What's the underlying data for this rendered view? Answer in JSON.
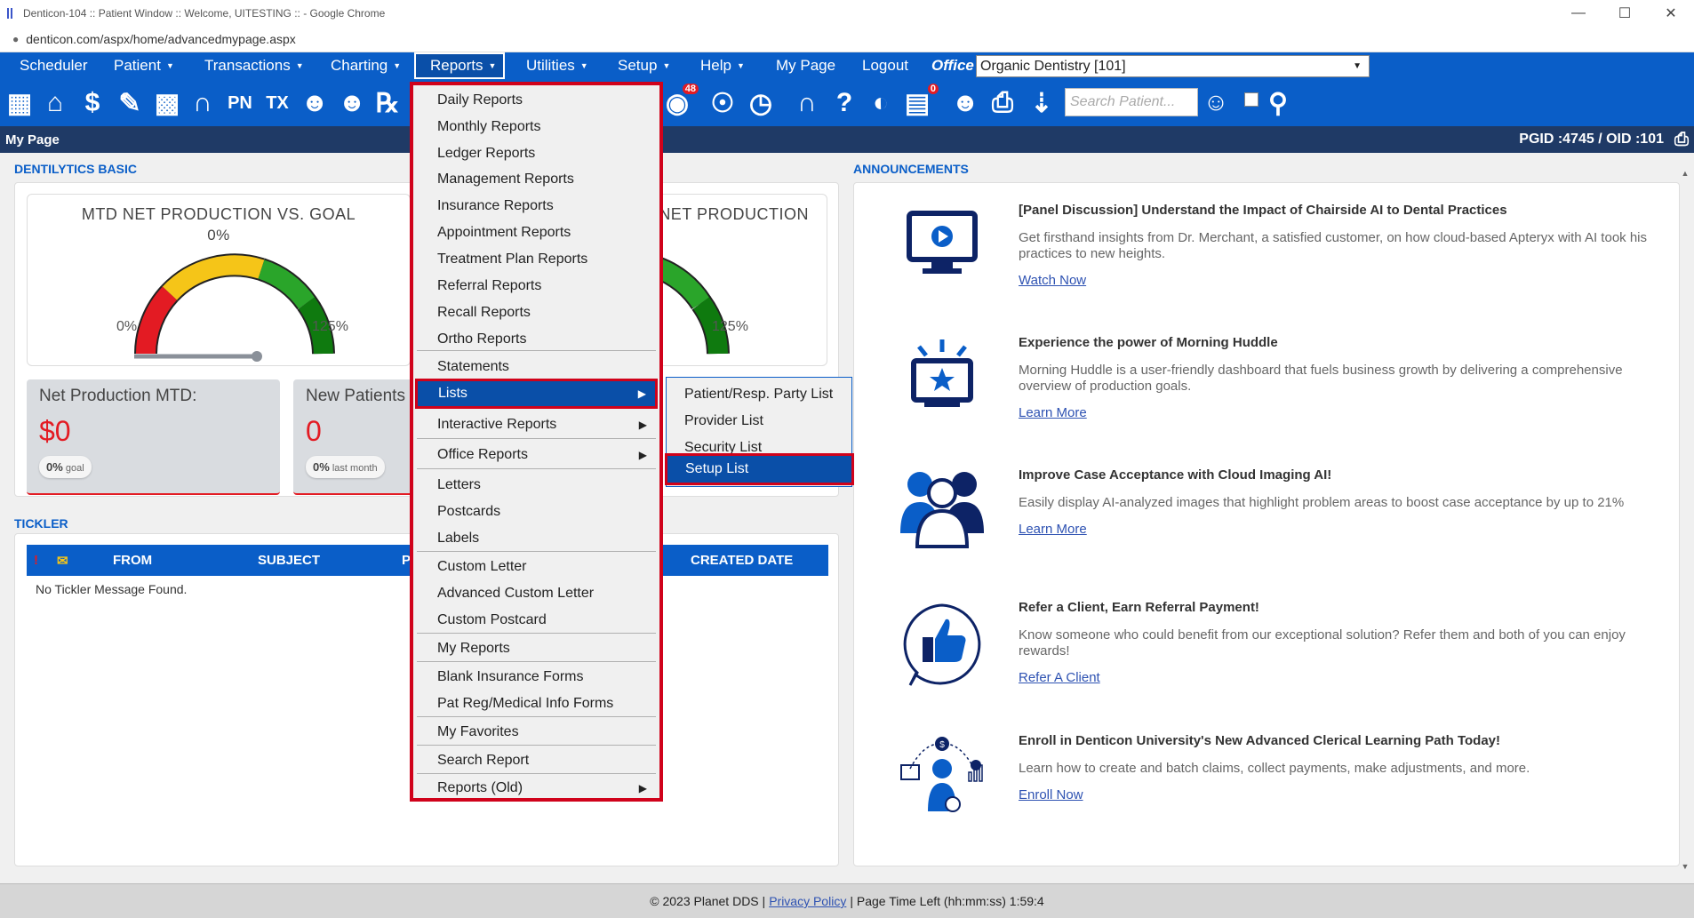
{
  "browser": {
    "title": "Denticon-104 :: Patient Window :: Welcome, UITESTING :: - Google Chrome",
    "url": "denticon.com/aspx/home/advancedmypage.aspx"
  },
  "menu": {
    "items": [
      {
        "label": "Scheduler",
        "caret": false
      },
      {
        "label": "Patient",
        "caret": true
      },
      {
        "label": "Transactions",
        "caret": true
      },
      {
        "label": "Charting",
        "caret": true
      },
      {
        "label": "Reports",
        "caret": true
      },
      {
        "label": "Utilities",
        "caret": true
      },
      {
        "label": "Setup",
        "caret": true
      },
      {
        "label": "Help",
        "caret": true
      },
      {
        "label": "My Page",
        "caret": false
      },
      {
        "label": "Logout",
        "caret": false
      }
    ],
    "office_label": "Office",
    "office_value": "Organic Dentistry [101]"
  },
  "toolbar": {
    "search_placeholder": "Search Patient...",
    "badges": {
      "alerts": "48",
      "eclaims": "0"
    },
    "icons": [
      "calendar-icon",
      "home-icon",
      "dollar-icon",
      "edit-icon",
      "tooth-icon",
      "tooth-chart-icon",
      "pn-icon",
      "tx-icon",
      "add-patient-icon",
      "add-family-icon",
      "rx-icon"
    ]
  },
  "pagebar": {
    "title": "My Page",
    "pgid": "PGID :4745  /  OID :101"
  },
  "dentilytics": {
    "label": "DENTILYTICS BASIC",
    "gauge1": {
      "title": "MTD NET PRODUCTION VS. GOAL",
      "value": "0%",
      "min": "0%",
      "max": "125%"
    },
    "gauge2": {
      "title": "NET PRODUCTION",
      "max": "125%"
    },
    "stats": [
      {
        "label": "Net Production MTD:",
        "value": "$0",
        "pill_value": "0%",
        "pill_text": "goal"
      },
      {
        "label": "New Patients",
        "value": "0",
        "pill_value": "0%",
        "pill_text": "last month"
      }
    ]
  },
  "tickler": {
    "label": "TICKLER",
    "columns": [
      "FROM",
      "SUBJECT",
      "P",
      "CREATED DATE"
    ],
    "empty": "No Tickler Message Found."
  },
  "announcements": {
    "label": "ANNOUNCEMENTS",
    "items": [
      {
        "title": "[Panel Discussion] Understand the Impact of Chairside AI to Dental Practices",
        "desc": "Get firsthand insights from Dr. Merchant, a satisfied customer, on how cloud-based Apteryx with AI took his practices to new heights.",
        "link": "Watch Now"
      },
      {
        "title": "Experience the power of Morning Huddle",
        "desc": "Morning Huddle is a user-friendly dashboard that fuels business growth by delivering a comprehensive overview of production goals.",
        "link": "Learn More"
      },
      {
        "title": "Improve Case Acceptance with Cloud Imaging AI!",
        "desc": "Easily display AI-analyzed images that highlight problem areas to boost case acceptance by up to 21%",
        "link": "Learn More"
      },
      {
        "title": "Refer a Client, Earn Referral Payment!",
        "desc": "Know someone who could benefit from our exceptional solution? Refer them and both of you can enjoy rewards!",
        "link": "Refer A Client"
      },
      {
        "title": "Enroll in Denticon University's New Advanced Clerical Learning Path Today!",
        "desc": "Learn how to create and batch claims, collect payments, make adjustments, and more.",
        "link": "Enroll Now"
      }
    ]
  },
  "reports_menu": {
    "items": [
      {
        "label": "Daily Reports"
      },
      {
        "label": "Monthly Reports"
      },
      {
        "label": "Ledger Reports"
      },
      {
        "label": "Management Reports"
      },
      {
        "label": "Insurance Reports"
      },
      {
        "label": "Appointment Reports"
      },
      {
        "label": "Treatment Plan Reports"
      },
      {
        "label": "Referral Reports"
      },
      {
        "label": "Recall Reports"
      },
      {
        "label": "Ortho Reports"
      },
      {
        "label": "Statements"
      },
      {
        "label": "Lists",
        "sub": true
      },
      {
        "label": "Interactive Reports",
        "sub": true
      },
      {
        "label": "Office Reports",
        "sub": true
      },
      {
        "label": "Letters"
      },
      {
        "label": "Postcards"
      },
      {
        "label": "Labels"
      },
      {
        "label": "Custom Letter"
      },
      {
        "label": "Advanced Custom Letter"
      },
      {
        "label": "Custom Postcard"
      },
      {
        "label": "My Reports"
      },
      {
        "label": "Blank Insurance Forms"
      },
      {
        "label": "Pat Reg/Medical Info Forms"
      },
      {
        "label": "My Favorites"
      },
      {
        "label": "Search Report"
      },
      {
        "label": "Reports (Old)",
        "sub": true
      }
    ]
  },
  "lists_submenu": {
    "items": [
      "Patient/Resp. Party List",
      "Provider List",
      "Security List",
      "Setup List"
    ]
  },
  "footer": {
    "copyright": "© 2023 Planet DDS |",
    "privacy": "Privacy Policy",
    "time_left": "| Page Time Left (hh:mm:ss) 1:59:4"
  }
}
